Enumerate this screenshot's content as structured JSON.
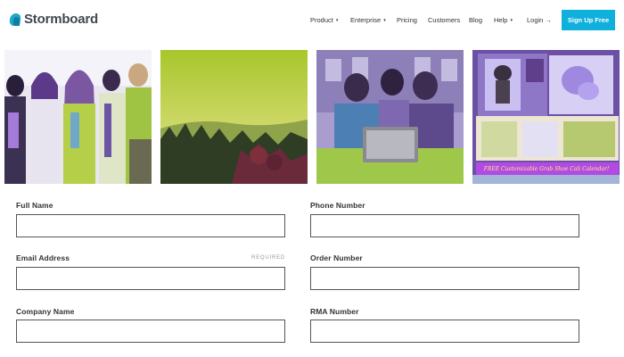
{
  "brand": {
    "name": "Stormboard"
  },
  "nav": {
    "items": [
      {
        "label": "Product",
        "dropdown": true
      },
      {
        "label": "Enterprise",
        "dropdown": true
      },
      {
        "label": "Pricing",
        "dropdown": false
      },
      {
        "label": "Customers",
        "dropdown": false
      },
      {
        "label": "Blog",
        "dropdown": false
      },
      {
        "label": "Help",
        "dropdown": true
      },
      {
        "label": "Login →",
        "dropdown": false
      }
    ],
    "caret": "▾",
    "signup": "Sign Up Free"
  },
  "images": {
    "calendar_banner": "FREE Customizable Grab Shoe Cali Calendar!"
  },
  "form": {
    "full_name": {
      "label": "Full Name",
      "value": ""
    },
    "phone_number": {
      "label": "Phone Number",
      "value": ""
    },
    "email_address": {
      "label": "Email Address",
      "required": "REQUIRED",
      "value": ""
    },
    "order_number": {
      "label": "Order Number",
      "value": ""
    },
    "company_name": {
      "label": "Company Name",
      "value": ""
    },
    "rma_number": {
      "label": "RMA Number",
      "value": ""
    }
  },
  "colors": {
    "accent": "#0fb0dc",
    "logo": "#1fa6c9",
    "purple_tint": "#8a6fd6",
    "green_tint": "#9cc23a"
  }
}
